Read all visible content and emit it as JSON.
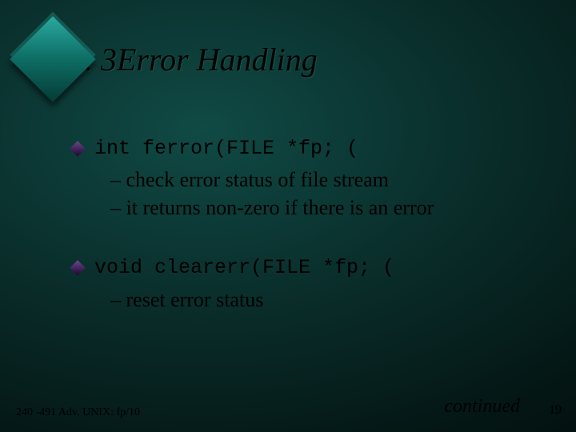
{
  "slide": {
    "title": ". 3Error Handling",
    "items": [
      {
        "code": "int ferror(FILE *fp; (",
        "subs": [
          "– check error status of file stream",
          "– it returns non-zero if there is an error"
        ]
      },
      {
        "code": "void clearerr(FILE *fp; (",
        "subs": [
          "– reset error status"
        ]
      }
    ],
    "footer_left": "240 -491 Adv. UNIX: fp/10",
    "continued": "continued",
    "page_number": "19"
  }
}
